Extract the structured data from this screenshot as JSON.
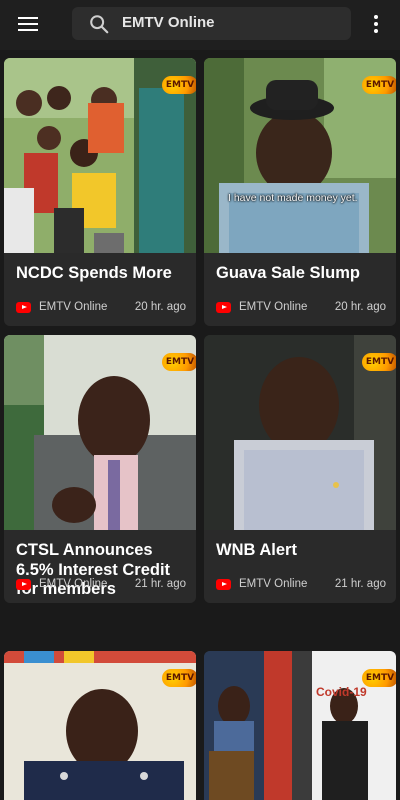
{
  "topbar": {
    "menu_icon": "hamburger-menu-icon",
    "search_text": "EMTV Online",
    "search_icon": "search-icon",
    "more_icon": "more-vertical-icon"
  },
  "colors": {
    "background": "#1a1a1a",
    "card": "#2a2a2a",
    "accent": "#ff0000",
    "logo": "#ff9a00"
  },
  "cards": [
    {
      "title": "NCDC Spends More",
      "channel": "EMTV Online",
      "time": "20 hr. ago",
      "logo_text": "EMTV",
      "caption": ""
    },
    {
      "title": "Guava Sale Slump",
      "channel": "EMTV Online",
      "time": "20 hr. ago",
      "logo_text": "EMTV",
      "caption": "I have not made money yet."
    },
    {
      "title": "CTSL Announces 6.5% Interest Credit for members",
      "channel": "EMTV Online",
      "time": "21 hr. ago",
      "logo_text": "EMTV",
      "caption": ""
    },
    {
      "title": "WNB Alert",
      "channel": "EMTV Online",
      "time": "21 hr. ago",
      "logo_text": "EMTV",
      "caption": ""
    },
    {
      "title": "",
      "channel": "",
      "time": "",
      "logo_text": "EMTV",
      "caption": ""
    },
    {
      "title": "",
      "channel": "",
      "time": "",
      "logo_text": "EMTV",
      "caption": "",
      "sign_text": "Covid-19"
    }
  ]
}
